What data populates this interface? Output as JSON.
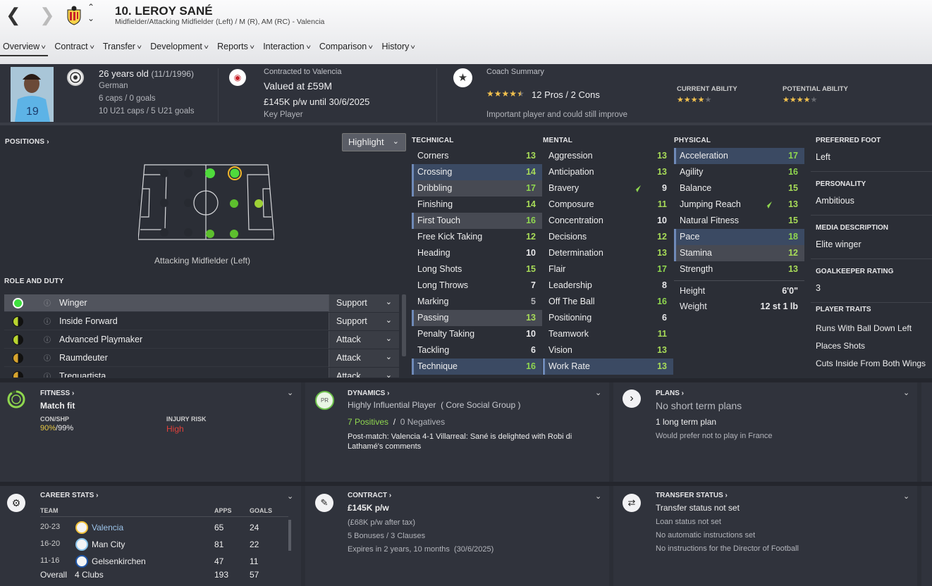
{
  "header": {
    "player_name": "10. LEROY SANÉ",
    "subtitle": "Midfielder/Attacking Midfielder (Left) / M (R), AM (RC) - Valencia",
    "tabs": [
      {
        "label": "Overview",
        "selected": true
      },
      {
        "label": "Contract"
      },
      {
        "label": "Transfer"
      },
      {
        "label": "Development"
      },
      {
        "label": "Reports"
      },
      {
        "label": "Interaction"
      },
      {
        "label": "Comparison"
      },
      {
        "label": "History"
      }
    ]
  },
  "summary": {
    "age": "26 years old",
    "dob": "(11/1/1996)",
    "nationality": "German",
    "caps": "6 caps / 0 goals",
    "u21_caps": "10 U21 caps / 5 U21 goals",
    "contract_label": "Contracted to Valencia",
    "value": "Valued at £59M",
    "wage": "£145K p/w until 30/6/2025",
    "squad_status": "Key Player",
    "coach_label": "Coach Summary",
    "pros_cons": "12 Pros / 2 Cons",
    "coach_comment": "Important player and could still improve",
    "current_ability_label": "CURRENT ABILITY",
    "potential_ability_label": "POTENTIAL ABILITY",
    "coach_stars": 4.5,
    "current_ability_stars": 4,
    "potential_ability_stars": 4
  },
  "positions": {
    "heading": "POSITIONS",
    "highlight_button": "Highlight",
    "position_label": "Attacking Midfielder (Left)"
  },
  "role_duty": {
    "heading": "ROLE AND DUTY",
    "roles": [
      {
        "name": "Winger",
        "duty": "Support",
        "suitability": "natural",
        "color": "#3ee03e"
      },
      {
        "name": "Inside Forward",
        "duty": "Support",
        "suitability": "accomplished",
        "color": "#b8d430"
      },
      {
        "name": "Advanced Playmaker",
        "duty": "Attack",
        "suitability": "accomplished",
        "color": "#b8d430"
      },
      {
        "name": "Raumdeuter",
        "duty": "Attack",
        "suitability": "competent",
        "color": "#d6a32e"
      },
      {
        "name": "Trequartista",
        "duty": "Attack",
        "suitability": "competent",
        "color": "#d6a32e"
      }
    ]
  },
  "attributes": {
    "technical": {
      "heading": "TECHNICAL",
      "items": [
        {
          "name": "Corners",
          "value": "13",
          "hl": ""
        },
        {
          "name": "Crossing",
          "value": "14",
          "hl": "key"
        },
        {
          "name": "Dribbling",
          "value": "17",
          "hl": "pref"
        },
        {
          "name": "Finishing",
          "value": "14",
          "hl": ""
        },
        {
          "name": "First Touch",
          "value": "16",
          "hl": "pref"
        },
        {
          "name": "Free Kick Taking",
          "value": "12",
          "hl": ""
        },
        {
          "name": "Heading",
          "value": "10",
          "hl": ""
        },
        {
          "name": "Long Shots",
          "value": "15",
          "hl": ""
        },
        {
          "name": "Long Throws",
          "value": "7",
          "hl": ""
        },
        {
          "name": "Marking",
          "value": "5",
          "hl": ""
        },
        {
          "name": "Passing",
          "value": "13",
          "hl": "pref"
        },
        {
          "name": "Penalty Taking",
          "value": "10",
          "hl": ""
        },
        {
          "name": "Tackling",
          "value": "6",
          "hl": ""
        },
        {
          "name": "Technique",
          "value": "16",
          "hl": "key"
        }
      ]
    },
    "mental": {
      "heading": "MENTAL",
      "items": [
        {
          "name": "Aggression",
          "value": "13",
          "hl": ""
        },
        {
          "name": "Anticipation",
          "value": "13",
          "hl": ""
        },
        {
          "name": "Bravery",
          "value": "9",
          "hl": "",
          "up": true
        },
        {
          "name": "Composure",
          "value": "11",
          "hl": ""
        },
        {
          "name": "Concentration",
          "value": "10",
          "hl": ""
        },
        {
          "name": "Decisions",
          "value": "12",
          "hl": ""
        },
        {
          "name": "Determination",
          "value": "13",
          "hl": ""
        },
        {
          "name": "Flair",
          "value": "17",
          "hl": ""
        },
        {
          "name": "Leadership",
          "value": "8",
          "hl": ""
        },
        {
          "name": "Off The Ball",
          "value": "16",
          "hl": ""
        },
        {
          "name": "Positioning",
          "value": "6",
          "hl": ""
        },
        {
          "name": "Teamwork",
          "value": "11",
          "hl": ""
        },
        {
          "name": "Vision",
          "value": "13",
          "hl": ""
        },
        {
          "name": "Work Rate",
          "value": "13",
          "hl": "key"
        }
      ]
    },
    "physical": {
      "heading": "PHYSICAL",
      "items": [
        {
          "name": "Acceleration",
          "value": "17",
          "hl": "key"
        },
        {
          "name": "Agility",
          "value": "16",
          "hl": ""
        },
        {
          "name": "Balance",
          "value": "15",
          "hl": ""
        },
        {
          "name": "Jumping Reach",
          "value": "13",
          "hl": "",
          "up": true
        },
        {
          "name": "Natural Fitness",
          "value": "15",
          "hl": ""
        },
        {
          "name": "Pace",
          "value": "18",
          "hl": "key"
        },
        {
          "name": "Stamina",
          "value": "12",
          "hl": "pref"
        },
        {
          "name": "Strength",
          "value": "13",
          "hl": ""
        }
      ]
    },
    "height_label": "Height",
    "height": "6'0\"",
    "weight_label": "Weight",
    "weight": "12 st 1 lb"
  },
  "info": {
    "preferred_foot_label": "PREFERRED FOOT",
    "preferred_foot": "Left",
    "personality_label": "PERSONALITY",
    "personality": "Ambitious",
    "media_label": "MEDIA DESCRIPTION",
    "media": "Elite winger",
    "gk_label": "GOALKEEPER RATING",
    "gk": "3",
    "traits_label": "PLAYER TRAITS",
    "traits": [
      "Runs With Ball Down Left",
      "Places Shots",
      "Cuts Inside From Both Wings"
    ]
  },
  "fitness": {
    "title": "FITNESS",
    "status": "Match fit",
    "con_label": "CON/SHP",
    "con": "90%",
    "shp": "/99%",
    "injury_label": "INJURY RISK",
    "injury": "High"
  },
  "dynamics": {
    "title": "DYNAMICS",
    "badge": "PR",
    "influence": "Highly Influential Player",
    "group": "( Core Social Group )",
    "positives": "7 Positives",
    "sep": "/",
    "negatives": "0 Negatives",
    "note": "Post-match: Valencia 4-1 Villarreal: Sané is delighted with Robi di Lathamé's comments"
  },
  "plans": {
    "title": "PLANS",
    "short": "No short term plans",
    "long": "1 long term plan",
    "note": "Would prefer not to play in France"
  },
  "career": {
    "title": "CAREER STATS",
    "col_team": "TEAM",
    "col_apps": "APPS",
    "col_goals": "GOALS",
    "rows": [
      {
        "years": "20-23",
        "team": "Valencia",
        "apps": "65",
        "goals": "24"
      },
      {
        "years": "16-20",
        "team": "Man City",
        "apps": "81",
        "goals": "22"
      },
      {
        "years": "11-16",
        "team": "Gelsenkirchen",
        "apps": "47",
        "goals": "11"
      }
    ],
    "overall_label": "Overall",
    "overall_clubs": "4 Clubs",
    "overall_apps": "193",
    "overall_goals": "57"
  },
  "contract": {
    "title": "CONTRACT",
    "wage": "£145K p/w",
    "after_tax": "(£68K p/w after tax)",
    "bonuses": "5 Bonuses / 3 Clauses",
    "expires": "Expires in 2 years, 10 months  (30/6/2025)"
  },
  "transfer": {
    "title": "TRANSFER STATUS",
    "status": "Transfer status not set",
    "loan": "Loan status not set",
    "auto": "No automatic instructions set",
    "dof": "No instructions for the Director of Football"
  },
  "colors": {
    "green": "#8fd64f",
    "highlight": "#3b4a63",
    "danger": "#e0413a",
    "star": "#f2c14e"
  }
}
